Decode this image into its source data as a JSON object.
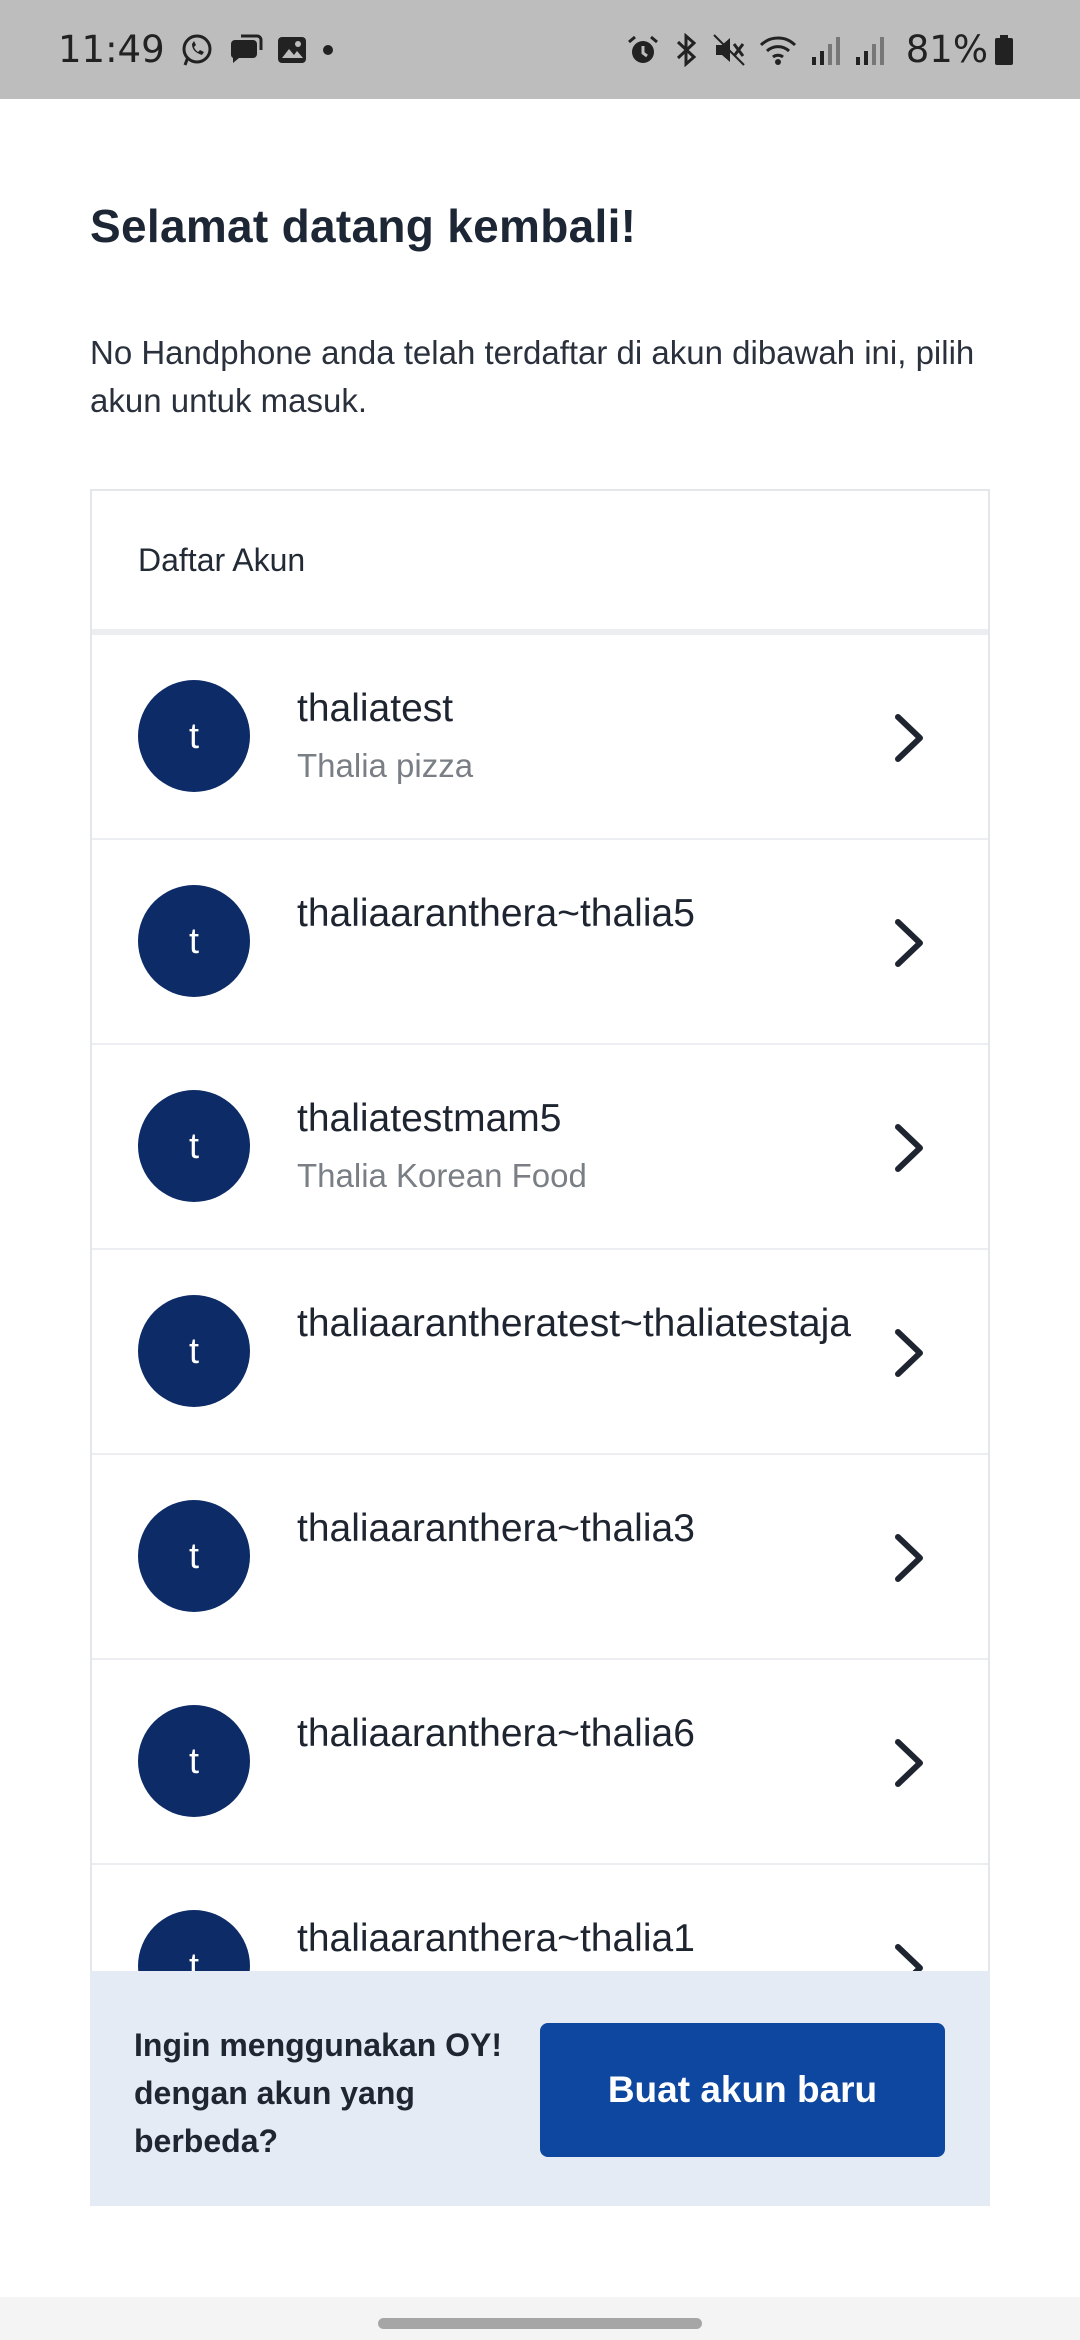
{
  "status_bar": {
    "time": "11:49",
    "battery": "81%",
    "left_icons": [
      "whatsapp-icon",
      "chat-icon",
      "gallery-icon",
      "dot-icon"
    ],
    "right_icons": [
      "alarm-icon",
      "bluetooth-icon",
      "mute-icon",
      "wifi-icon",
      "signal-icon",
      "signal-icon",
      "battery-icon"
    ]
  },
  "header": {
    "title": "Selamat datang kembali!",
    "subtitle": "No Handphone anda telah terdaftar di akun dibawah ini, pilih akun untuk masuk."
  },
  "account_list": {
    "heading": "Daftar Akun",
    "accounts": [
      {
        "initial": "t",
        "name": "thaliatest",
        "subtitle": "Thalia pizza"
      },
      {
        "initial": "t",
        "name": "thaliaaranthera~thalia5",
        "subtitle": ""
      },
      {
        "initial": "t",
        "name": "thaliatestmam5",
        "subtitle": "Thalia Korean Food"
      },
      {
        "initial": "t",
        "name": "thaliaarantheratest~thaliatestaja",
        "subtitle": ""
      },
      {
        "initial": "t",
        "name": "thaliaaranthera~thalia3",
        "subtitle": ""
      },
      {
        "initial": "t",
        "name": "thaliaaranthera~thalia6",
        "subtitle": ""
      },
      {
        "initial": "t",
        "name": "thaliaaranthera~thalia1",
        "subtitle": ""
      }
    ]
  },
  "footer": {
    "prompt": "Ingin menggunakan OY! dengan akun yang berbeda?",
    "button_label": "Buat akun baru"
  },
  "colors": {
    "avatar_bg": "#0d2b66",
    "button_bg": "#0e479f",
    "banner_bg": "#e4ebf5",
    "status_bar_bg": "#bdbdbd"
  }
}
